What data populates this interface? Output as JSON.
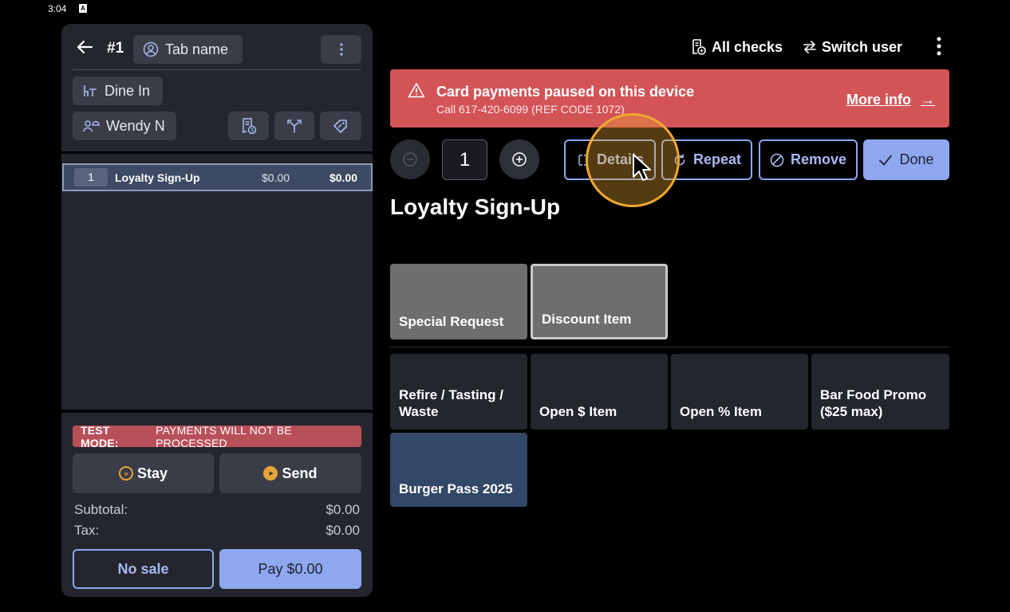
{
  "status_bar": {
    "time": "3:04",
    "icon": "A"
  },
  "check": {
    "back_icon": "arrow-left-icon",
    "number": "#1",
    "tab_name": "Tab name",
    "dining_option": "Dine In",
    "server": "Wendy N"
  },
  "order": {
    "items": [
      {
        "qty": "1",
        "name": "Loyalty Sign-Up",
        "price": "$0.00",
        "total": "$0.00"
      }
    ]
  },
  "footer": {
    "test_mode_label": "TEST MODE:",
    "test_mode_text": "PAYMENTS WILL NOT BE PROCESSED",
    "stay_label": "Stay",
    "send_label": "Send",
    "subtotal_label": "Subtotal:",
    "subtotal_value": "$0.00",
    "tax_label": "Tax:",
    "tax_value": "$0.00",
    "no_sale_label": "No sale",
    "pay_label": "Pay $0.00"
  },
  "topbar": {
    "all_checks": "All checks",
    "switch_user": "Switch user"
  },
  "alert": {
    "title": "Card payments paused on this device",
    "subtitle": "Call 617-420-6099 (REF CODE 1072)",
    "link": "More info",
    "link_arrow": "→",
    "color": "#d35457"
  },
  "item_controls": {
    "quantity": "1",
    "details": "Details",
    "repeat": "Repeat",
    "remove": "Remove",
    "done": "Done"
  },
  "selected_item_title": "Loyalty Sign-Up",
  "tiles": {
    "special_request": "Special Request",
    "discount_item": "Discount Item",
    "refire": "Refire / Tasting / Waste",
    "open_dollar": "Open $ Item",
    "open_percent": "Open % Item",
    "bar_food_promo": "Bar Food Promo ($25 max)",
    "burger_pass": "Burger Pass 2025"
  },
  "colors": {
    "accent": "#8ea7ee",
    "alert": "#d35457",
    "test_mode": "#b8505a",
    "highlight": "#f0a832"
  }
}
